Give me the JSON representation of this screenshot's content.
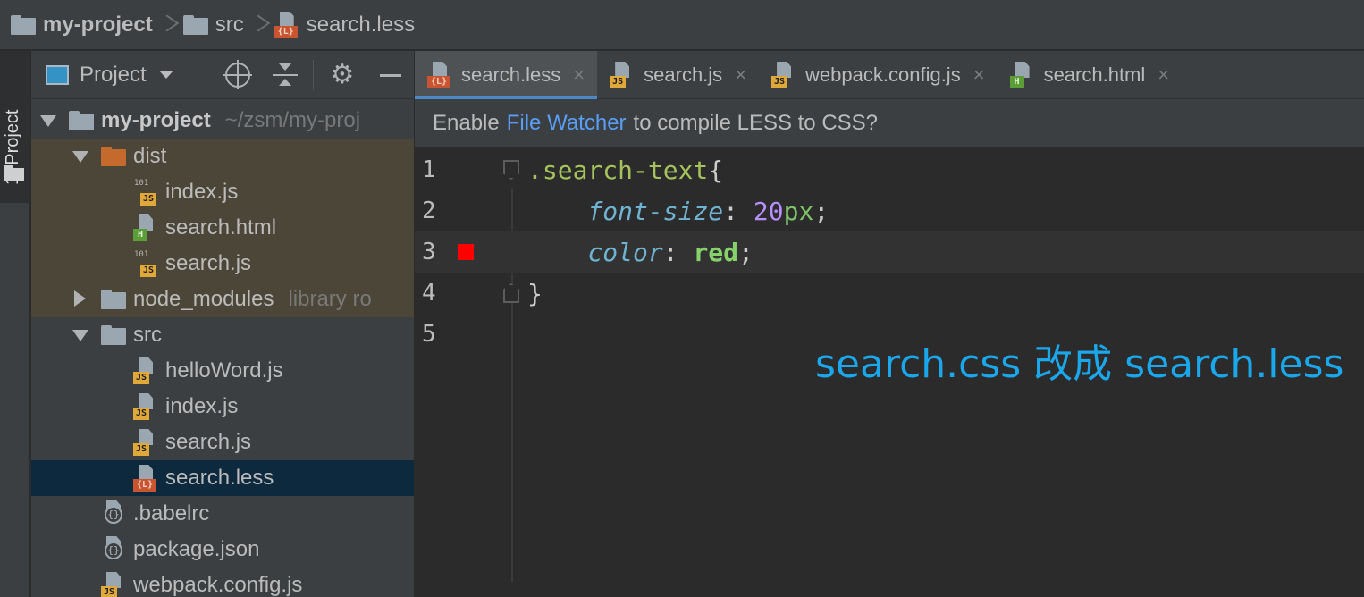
{
  "breadcrumb": {
    "project": "my-project",
    "folder": "src",
    "file": "search.less",
    "file_badge": "{L}"
  },
  "toolstrip": {
    "label": "1: Project"
  },
  "panel": {
    "selector_label": "Project",
    "icons": [
      "target-icon",
      "collapse-all-icon",
      "gear-icon",
      "minimize-icon"
    ]
  },
  "tree": {
    "root": {
      "name": "my-project",
      "path": "~/zsm/my-proj"
    },
    "dist": {
      "name": "dist"
    },
    "dist_files": [
      {
        "name": "index.js",
        "badge": "JS",
        "bin": "101"
      },
      {
        "name": "search.html",
        "badge": "H"
      },
      {
        "name": "search.js",
        "badge": "JS",
        "bin": "101"
      }
    ],
    "node_modules": {
      "name": "node_modules",
      "suffix": "library ro"
    },
    "src": {
      "name": "src"
    },
    "src_files": [
      {
        "name": "helloWord.js",
        "badge": "JS"
      },
      {
        "name": "index.js",
        "badge": "JS"
      },
      {
        "name": "search.js",
        "badge": "JS"
      },
      {
        "name": "search.less",
        "badge": "{L}"
      }
    ],
    "root_files": [
      {
        "name": ".babelrc"
      },
      {
        "name": "package.json"
      },
      {
        "name": "webpack.config.js",
        "badge": "JS"
      }
    ]
  },
  "tabs": [
    {
      "label": "search.less",
      "badge": "{L}",
      "close": "×"
    },
    {
      "label": "search.js",
      "badge": "JS",
      "close": "×"
    },
    {
      "label": "webpack.config.js",
      "badge": "JS",
      "close": "×"
    },
    {
      "label": "search.html",
      "badge": "H",
      "close": "×"
    }
  ],
  "banner": {
    "prefix": "Enable",
    "link": "File Watcher",
    "suffix": "to compile LESS to CSS?"
  },
  "code": {
    "line_numbers": [
      "1",
      "2",
      "3",
      "4",
      "5"
    ],
    "selector": ".search-text",
    "open_brace": "{",
    "prop1": "font-size",
    "colon": ":",
    "num1": "20",
    "unit1": "px",
    "semicolon": ";",
    "prop2": "color",
    "val2": "red",
    "close_brace": "}",
    "color_marker": "#ff0000"
  },
  "annotation": "search.css 改成 search.less"
}
